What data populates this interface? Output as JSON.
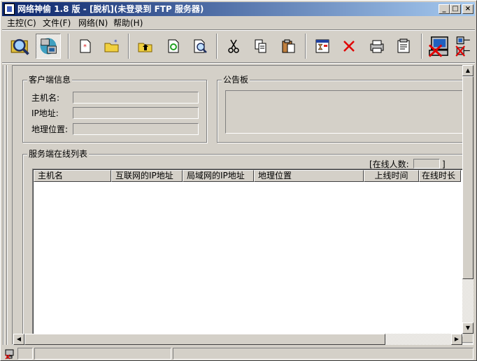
{
  "window": {
    "title": "网络神偷 1.8 版 - [脱机](未登录到 FTP 服务器)",
    "min_label": "_",
    "max_label": "□",
    "close_label": "×"
  },
  "menu": [
    {
      "label": "主控(C)"
    },
    {
      "label": "文件(F)"
    },
    {
      "label": "网络(N)"
    },
    {
      "label": "帮助(H)"
    }
  ],
  "toolbar": [
    {
      "icon": "search-icon"
    },
    {
      "icon": "network-computers-icon"
    },
    {
      "icon": "new-file-icon"
    },
    {
      "icon": "new-folder-icon"
    },
    {
      "icon": "folder-up-icon"
    },
    {
      "icon": "refresh-icon"
    },
    {
      "icon": "find-file-icon"
    },
    {
      "icon": "cut-icon"
    },
    {
      "icon": "copy-icon"
    },
    {
      "icon": "paste-icon"
    },
    {
      "icon": "schedule-icon"
    },
    {
      "icon": "delete-icon"
    },
    {
      "icon": "view-icon"
    },
    {
      "icon": "properties-icon"
    },
    {
      "icon": "disconnect-icon"
    },
    {
      "icon": "network-status-icon"
    }
  ],
  "client_info": {
    "group_title": "客户端信息",
    "host_label": "主机名:",
    "ip_label": "IP地址:",
    "location_label": "地理位置:",
    "host_value": "",
    "ip_value": "",
    "location_value": ""
  },
  "notice": {
    "group_title": "公告板",
    "content": ""
  },
  "server_list": {
    "group_title": "服务端在线列表",
    "online_prefix": "[在线人数:",
    "online_suffix": "]",
    "online_count": "",
    "columns": [
      "主机名",
      "互联网的IP地址",
      "局域网的IP地址",
      "地理位置",
      "上线时间",
      "在线时长"
    ],
    "rows": []
  },
  "status": {
    "pane1": "",
    "pane2": ""
  }
}
